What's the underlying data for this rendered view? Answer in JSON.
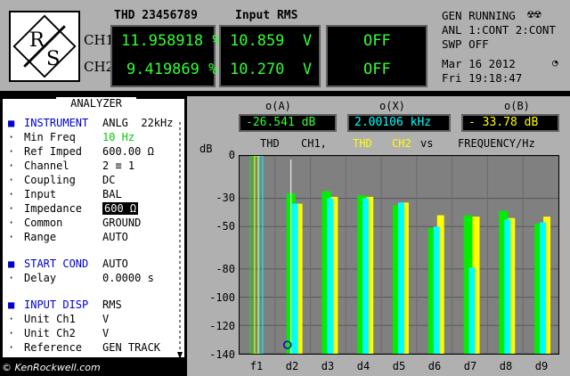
{
  "header": {
    "thd_label": "THD 23456789",
    "rms_label": "Input RMS",
    "ch1_label": "CH1",
    "ch2_label": "CH2",
    "ch1_thd": "11.958918 %",
    "ch2_thd": "9.419869 %",
    "ch1_rms": "10.859  V",
    "ch2_rms": "10.270  V",
    "off1": "OFF",
    "off2": "OFF",
    "gen_status": "GEN RUNNING",
    "anl_status": "ANL 1:CONT 2:CONT",
    "swp_status": "SWP OFF",
    "date": "Mar 16 2012",
    "time": "Fri 19:18:47"
  },
  "analyzer": {
    "title": "ANALYZER",
    "rows": [
      {
        "bullet": "■",
        "label": "INSTRUMENT",
        "value": "ANLG  22kHz",
        "section": true
      },
      {
        "bullet": "·",
        "label": "Min Freq",
        "value": "10 Hz",
        "green": true
      },
      {
        "bullet": "·",
        "label": "Ref Imped",
        "value": "600.00 Ω"
      },
      {
        "bullet": "·",
        "label": "Channel",
        "value": "2 ≡ 1"
      },
      {
        "bullet": "·",
        "label": "Coupling",
        "value": "DC"
      },
      {
        "bullet": "·",
        "label": "Input",
        "value": "BAL"
      },
      {
        "bullet": "·",
        "label": "Impedance",
        "value": "600 Ω",
        "selected": true
      },
      {
        "bullet": "·",
        "label": "Common",
        "value": "GROUND"
      },
      {
        "bullet": "·",
        "label": "Range",
        "value": "AUTO"
      },
      {
        "bullet": "■",
        "label": "START COND",
        "value": "AUTO",
        "section": true
      },
      {
        "bullet": "·",
        "label": "Delay",
        "value": "0.0000 s"
      },
      {
        "bullet": "■",
        "label": "INPUT DISP",
        "value": "RMS",
        "section": true
      },
      {
        "bullet": "·",
        "label": "Unit Ch1",
        "value": "V"
      },
      {
        "bullet": "·",
        "label": "Unit Ch2",
        "value": "V"
      },
      {
        "bullet": "·",
        "label": "Reference",
        "value": "GEN TRACK"
      }
    ]
  },
  "cursors": {
    "a_label": "o(A)",
    "x_label": "o(X)",
    "b_label": "o(B)",
    "a_value": "-26.541 dB",
    "x_value": "2.00106 kHz",
    "b_value": "- 33.78 dB"
  },
  "legend": {
    "thd": "THD",
    "ch1": "CH1,",
    "thd2": "THD",
    "ch2": "CH2",
    "vs": "vs",
    "freq": "FREQUENCY/Hz",
    "unit": "dB"
  },
  "colors": {
    "ch1": "#00ee00",
    "ch2": "#ffff00",
    "cyan": "#00ffff",
    "cursor_a": "#33ff33",
    "cursor_x": "#00ffff",
    "cursor_b": "#ffff00"
  },
  "chart_data": {
    "type": "bar",
    "categories": [
      "f1",
      "d2",
      "d3",
      "d4",
      "d5",
      "d6",
      "d7",
      "d8",
      "d9"
    ],
    "series": [
      {
        "name": "CH1",
        "values": [
          0,
          -26.5,
          -25,
          -28,
          -35,
          -51,
          -42,
          -39,
          -48
        ]
      },
      {
        "name": "CH2",
        "values": [
          0,
          -33.8,
          -29,
          -29,
          -33,
          -42,
          -43,
          -44,
          -43
        ]
      },
      {
        "values": [
          0,
          -33.8,
          -30,
          -30,
          -33,
          -50,
          -79,
          -45,
          -47
        ]
      }
    ],
    "ylim": [
      -140,
      0
    ],
    "yticks": [
      "0",
      "-30",
      "-50",
      "-80",
      "-100",
      "-120",
      "-140"
    ],
    "grid": true
  }
}
